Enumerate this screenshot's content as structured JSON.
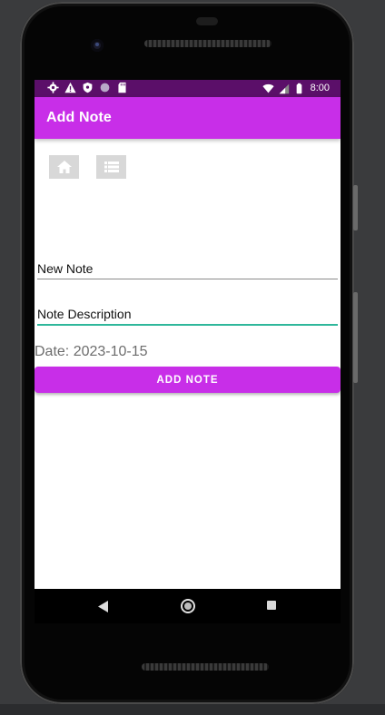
{
  "status_bar": {
    "time": "8:00",
    "left_icons": [
      "settings-gear-icon",
      "warning-icon",
      "shield-icon",
      "circle-icon",
      "sd-card-icon"
    ],
    "right_icons": [
      "wifi-icon",
      "cell-signal-icon",
      "battery-icon"
    ]
  },
  "app_bar": {
    "title": "Add Note"
  },
  "toolbar": {
    "icons": [
      "home-icon",
      "list-icon"
    ]
  },
  "form": {
    "title_value": "New Note",
    "description_value": "Note Description",
    "date_text": "Date: 2023-10-15",
    "submit_label": "ADD NOTE"
  },
  "nav_bar": {
    "icons": [
      "back-icon",
      "home-nav-icon",
      "recents-icon"
    ]
  },
  "colors": {
    "accent": "#c82ee8",
    "status_bar": "#5b0f69",
    "focus_underline": "#2fb79b"
  }
}
